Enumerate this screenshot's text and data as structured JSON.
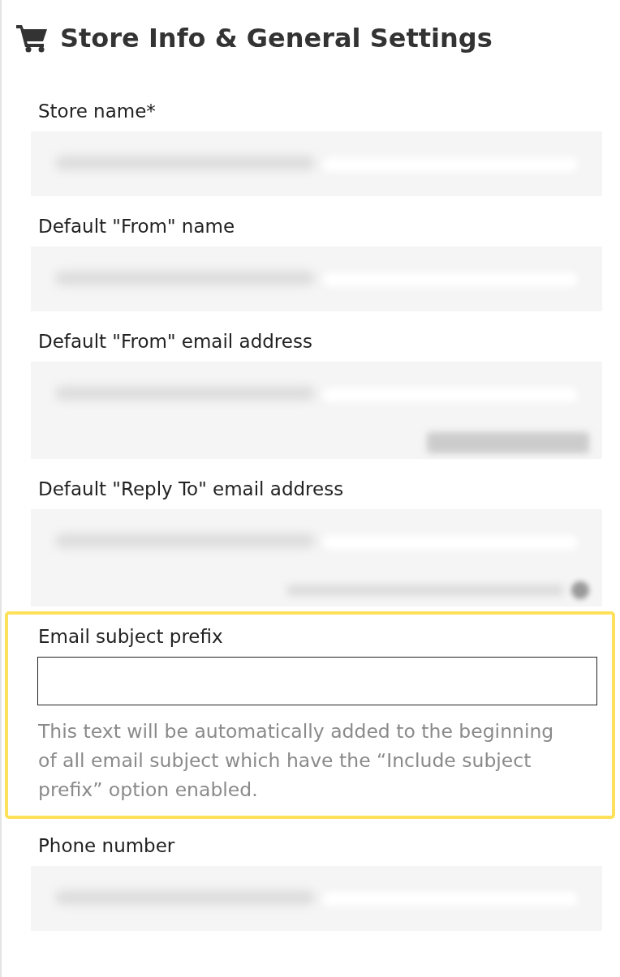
{
  "header": {
    "title": "Store Info & General Settings"
  },
  "fields": [
    {
      "label": "Store name",
      "required_mark": "*",
      "kind": "blurred"
    },
    {
      "label": "Default \"From\" name",
      "kind": "blurred"
    },
    {
      "label": "Default \"From\" email address",
      "kind": "blurred",
      "has_button": true
    },
    {
      "label": "Default \"Reply To\" email address",
      "kind": "blurred",
      "has_toggle": true
    },
    {
      "label": "Email subject prefix",
      "kind": "input",
      "highlighted": true,
      "help": "This text will be automatically added to the beginning of all email subject which have the “Include subject prefix” option enabled."
    },
    {
      "label": "Phone number",
      "kind": "blurred"
    }
  ]
}
